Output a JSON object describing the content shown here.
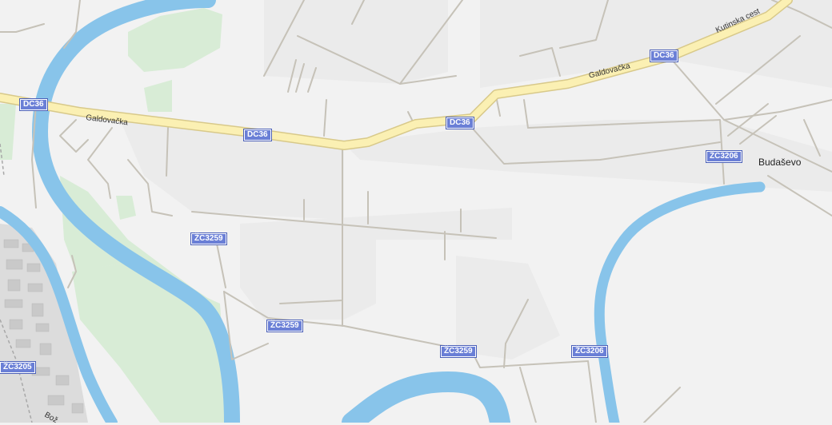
{
  "colors": {
    "background": "#f2f2f2",
    "water": "#88c4ea",
    "park": "#d8ecd6",
    "main_road": "#fbf0b3",
    "shield": "#6a7fd6"
  },
  "places": {
    "budasevo": "Budaševo"
  },
  "streets": {
    "galdovacka_west": "Galdovačka",
    "galdovacka_east": "Galdovačka",
    "kutinska": "Kutinska cest",
    "bottom_left": "Bož"
  },
  "shields": {
    "dc36_a": "DC36",
    "dc36_b": "DC36",
    "dc36_c": "DC36",
    "dc36_d": "DC36",
    "zc3259_a": "ŽC3259",
    "zc3259_b": "ŽC3259",
    "zc3259_c": "ŽC3259",
    "zc3206_a": "ŽC3206",
    "zc3206_b": "ŽC3206",
    "zc3205": "ŽC3205"
  }
}
